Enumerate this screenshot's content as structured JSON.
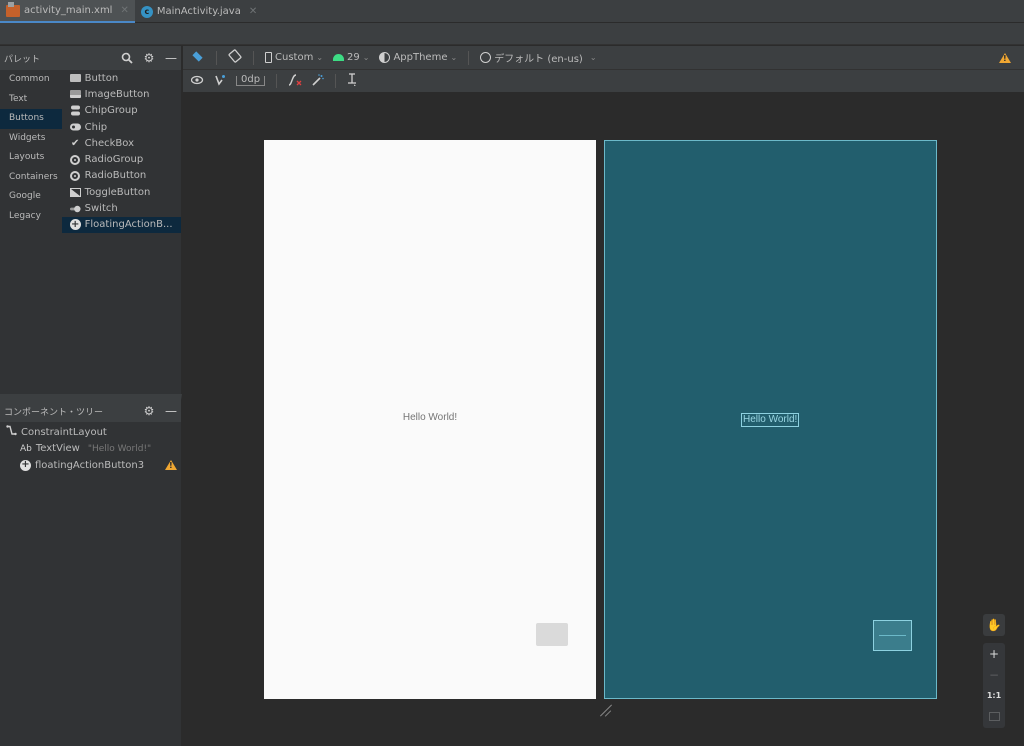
{
  "tabs": [
    {
      "label": "activity_main.xml",
      "icon": "xml-layout-icon",
      "active": true
    },
    {
      "label": "MainActivity.java",
      "icon": "java-class-icon",
      "active": false
    }
  ],
  "palette": {
    "title": "パレット",
    "categories": [
      "Common",
      "Text",
      "Buttons",
      "Widgets",
      "Layouts",
      "Containers",
      "Google",
      "Legacy"
    ],
    "selected_category": "Buttons",
    "widgets": [
      {
        "label": "Button",
        "icon": "button-icon"
      },
      {
        "label": "ImageButton",
        "icon": "image-button-icon"
      },
      {
        "label": "ChipGroup",
        "icon": "chip-group-icon"
      },
      {
        "label": "Chip",
        "icon": "chip-icon"
      },
      {
        "label": "CheckBox",
        "icon": "checkmark-icon"
      },
      {
        "label": "RadioGroup",
        "icon": "radio-group-icon"
      },
      {
        "label": "RadioButton",
        "icon": "radio-button-icon"
      },
      {
        "label": "ToggleButton",
        "icon": "toggle-button-icon"
      },
      {
        "label": "Switch",
        "icon": "switch-icon"
      },
      {
        "label": "FloatingActionB...",
        "icon": "fab-plus-icon"
      }
    ],
    "selected_widget": "FloatingActionB..."
  },
  "component_tree": {
    "title": "コンポーネント・ツリー",
    "items": [
      {
        "label": "ConstraintLayout",
        "icon": "constraint-layout-icon"
      },
      {
        "label": "TextView",
        "prefix": "Ab",
        "hint": "\"Hello World!\"",
        "icon": "textview-icon"
      },
      {
        "label": "floatingActionButton3",
        "icon": "fab-plus-icon",
        "warning": true
      }
    ]
  },
  "toolbar": {
    "device": "Custom",
    "api_level": "29",
    "theme": "AppTheme",
    "locale": "デフォルト (en-us)",
    "margin": "0dp",
    "warning": true
  },
  "canvas": {
    "design_text": "Hello World!",
    "blueprint_text": "Hello World!"
  },
  "zoom_controls": {
    "pan": "pan-hand-icon",
    "zoom_in": "+",
    "zoom_out": "−",
    "actual_size": "1:1",
    "fit": "fit-screen-icon"
  }
}
